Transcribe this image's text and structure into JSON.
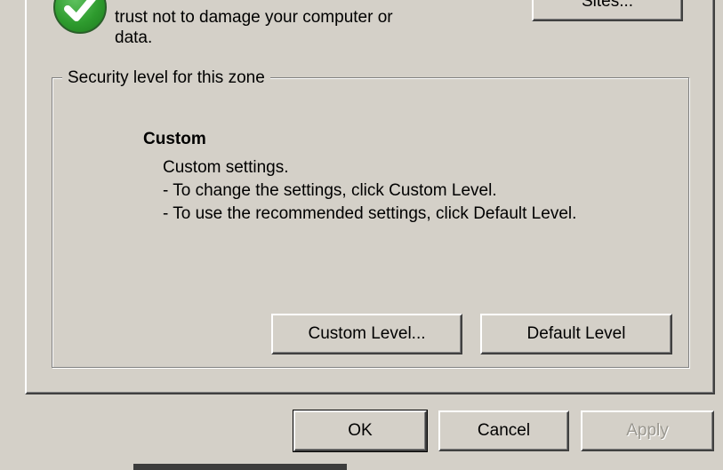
{
  "zone": {
    "description_line1": "trust not to damage your computer or",
    "description_line2": "data.",
    "sites_button_label": "Sites..."
  },
  "security_group": {
    "legend": "Security level for this zone",
    "level_name": "Custom",
    "level_description": [
      "Custom settings.",
      "- To change the settings, click Custom Level.",
      "- To use the recommended settings, click Default Level."
    ],
    "custom_level_button": "Custom Level...",
    "default_level_button": "Default Level"
  },
  "dialog_buttons": {
    "ok": "OK",
    "cancel": "Cancel",
    "apply": "Apply"
  },
  "icons": {
    "zone_icon": "trusted-sites-check-icon"
  },
  "colors": {
    "dialog_bg": "#d4d0c8",
    "check_green": "#2e9b2e",
    "disabled_text": "#9a978f"
  }
}
